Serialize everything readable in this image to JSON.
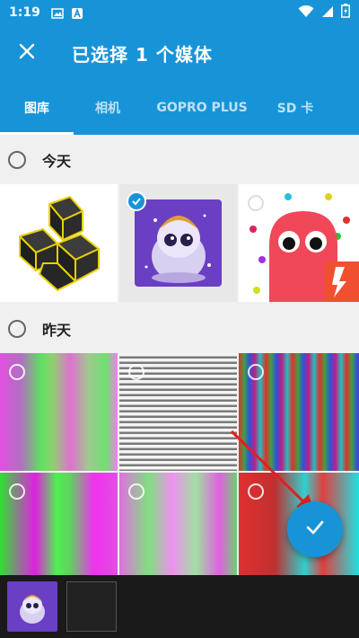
{
  "status_bar": {
    "time": "1:19"
  },
  "app_bar": {
    "title": "已选择 1 个媒体",
    "close_icon": "close-icon"
  },
  "tabs": [
    {
      "label": "图库",
      "active": true
    },
    {
      "label": "相机",
      "active": false
    },
    {
      "label": "GOPRO PLUS",
      "active": false
    },
    {
      "label": "SD 卡",
      "active": false
    }
  ],
  "sections": [
    {
      "label": "今天"
    },
    {
      "label": "昨天"
    }
  ],
  "colors": {
    "accent": "#1794d8",
    "bottom_bar": "#1a1a1a",
    "background": "#f0f0f0"
  },
  "selected_count": 1
}
